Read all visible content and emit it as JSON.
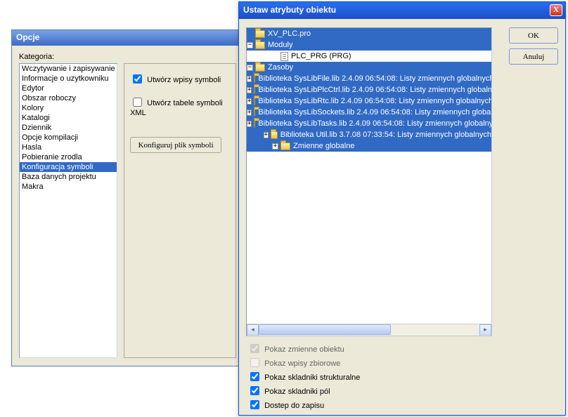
{
  "options": {
    "title": "Opcje",
    "category_label": "Kategoria:",
    "categories": [
      "Wczytywanie i zapisywanie",
      "Informacje o uzytkowniku",
      "Edytor",
      "Obszar roboczy",
      "Kolory",
      "Katalogi",
      "Dziennik",
      "Opcje kompilacji",
      "Hasla",
      "Pobieranie zrodla",
      "Konfiguracja symboli",
      "Baza danych projektu",
      "Makra"
    ],
    "selected_index": 10,
    "checkbox_create_entries": "Utwórz wpisy symboli",
    "checkbox_create_xml": "Utwórz tabele symboli XML",
    "config_button": "Konfiguruj plik symboli"
  },
  "attr": {
    "title": "Ustaw atrybuty obiektu",
    "ok": "OK",
    "cancel": "Anuluj",
    "tree": {
      "root": "XV_PLC.pro",
      "modules_label": "Moduly",
      "prg_label": "PLC_PRG (PRG)",
      "resources_label": "Zasoby",
      "libs": [
        "Biblioteka SysLibFile.lib 2.4.09 06:54:08: Listy zmiennych globalnych",
        "Biblioteka SysLibPlcCtrl.lib 2.4.09 06:54:08: Listy zmiennych globalnych",
        "Biblioteka SysLibRtc.lib 2.4.09 06:54:08: Listy zmiennych globalnych",
        "Biblioteka SysLibSockets.lib 2.4.09 06:54:08: Listy zmiennych globalnych",
        "Biblioteka SysLibTasks.lib 2.4.09 06:54:08: Listy zmiennych globalnych",
        "Biblioteka Util.lib 3.7.08 07:33:54: Listy zmiennych globalnych"
      ],
      "globals": "Zmienne globalne"
    },
    "cb_show_obj": "Pokaz zmienne obiektu",
    "cb_show_coll": "Pokaz wpisy zbiorowe",
    "cb_show_struct": "Pokaz skladniki strukturalne",
    "cb_show_fields": "Pokaz skladniki pól",
    "cb_write_access": "Dostep do zapisu"
  }
}
